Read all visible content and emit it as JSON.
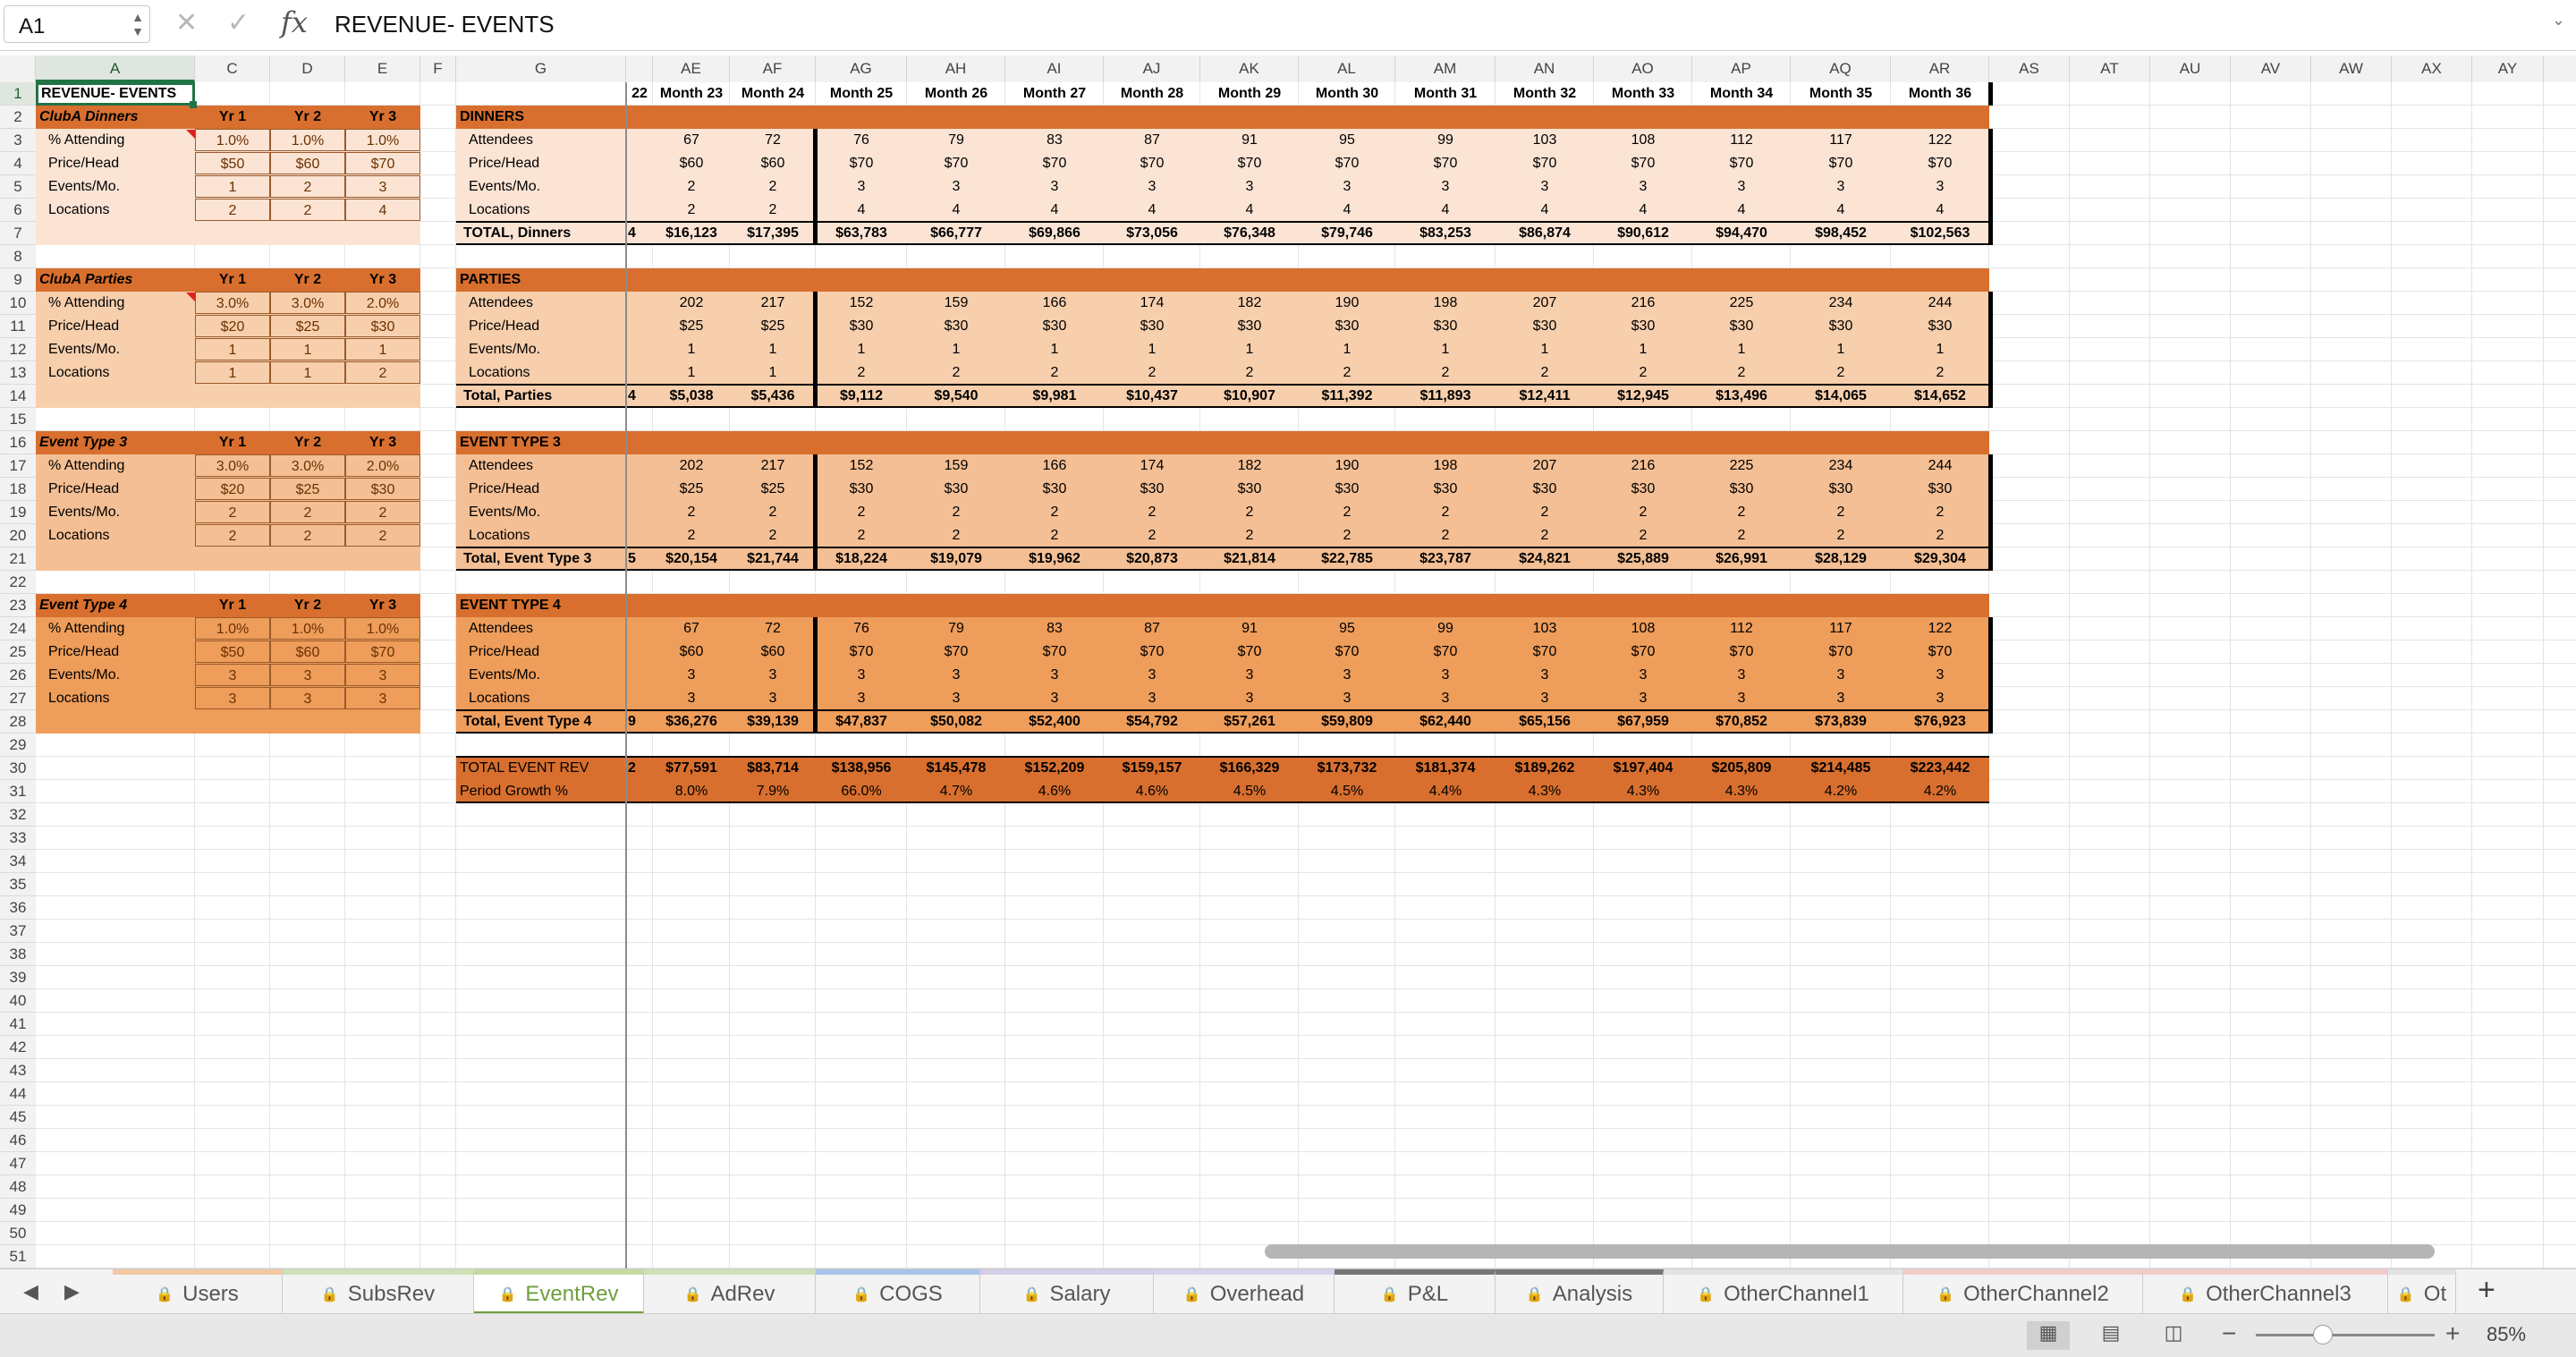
{
  "formula_bar": {
    "name_box": "A1",
    "formula": "REVENUE- EVENTS"
  },
  "columns": [
    "A",
    "C",
    "D",
    "E",
    "F",
    "G",
    "",
    "AE",
    "AF",
    "AG",
    "AH",
    "AI",
    "AJ",
    "AK",
    "AL",
    "AM",
    "AN",
    "AO",
    "AP",
    "AQ",
    "AR",
    "AS",
    "AT",
    "AU",
    "AV",
    "AW",
    "AX",
    "AY"
  ],
  "rows": [
    "1",
    "2",
    "3",
    "4",
    "5",
    "6",
    "7",
    "8",
    "9",
    "10",
    "11",
    "12",
    "13",
    "14",
    "15",
    "16",
    "17",
    "18",
    "19",
    "20",
    "21",
    "22",
    "23",
    "24",
    "25",
    "26",
    "27",
    "28",
    "29",
    "30",
    "31",
    "32",
    "33",
    "34",
    "35",
    "36",
    "37",
    "38",
    "39",
    "40",
    "41",
    "42",
    "43",
    "44",
    "45",
    "46",
    "47",
    "48",
    "49",
    "50",
    "51"
  ],
  "sheet_title": "REVENUE- EVENTS",
  "month_headers": {
    "partial": "22",
    "months": [
      "Month 23",
      "Month 24",
      "Month 25",
      "Month 26",
      "Month 27",
      "Month 28",
      "Month 29",
      "Month 30",
      "Month 31",
      "Month 32",
      "Month 33",
      "Month 34",
      "Month 35",
      "Month 36"
    ]
  },
  "left_blocks": [
    {
      "title": "ClubA Dinners",
      "years": [
        "Yr 1",
        "Yr 2",
        "Yr 3"
      ],
      "rows": [
        {
          "label": "% Attending",
          "vals": [
            "1.0%",
            "1.0%",
            "1.0%"
          ]
        },
        {
          "label": "Price/Head",
          "vals": [
            "$50",
            "$60",
            "$70"
          ]
        },
        {
          "label": "Events/Mo.",
          "vals": [
            "1",
            "2",
            "3"
          ]
        },
        {
          "label": "Locations",
          "vals": [
            "2",
            "2",
            "4"
          ]
        }
      ]
    },
    {
      "title": "ClubA Parties",
      "years": [
        "Yr 1",
        "Yr 2",
        "Yr 3"
      ],
      "rows": [
        {
          "label": "% Attending",
          "vals": [
            "3.0%",
            "3.0%",
            "2.0%"
          ]
        },
        {
          "label": "Price/Head",
          "vals": [
            "$20",
            "$25",
            "$30"
          ]
        },
        {
          "label": "Events/Mo.",
          "vals": [
            "1",
            "1",
            "1"
          ]
        },
        {
          "label": "Locations",
          "vals": [
            "1",
            "1",
            "2"
          ]
        }
      ]
    },
    {
      "title": "Event Type 3",
      "years": [
        "Yr 1",
        "Yr 2",
        "Yr 3"
      ],
      "rows": [
        {
          "label": "% Attending",
          "vals": [
            "3.0%",
            "3.0%",
            "2.0%"
          ]
        },
        {
          "label": "Price/Head",
          "vals": [
            "$20",
            "$25",
            "$30"
          ]
        },
        {
          "label": "Events/Mo.",
          "vals": [
            "2",
            "2",
            "2"
          ]
        },
        {
          "label": "Locations",
          "vals": [
            "2",
            "2",
            "2"
          ]
        }
      ]
    },
    {
      "title": "Event Type 4",
      "years": [
        "Yr 1",
        "Yr 2",
        "Yr 3"
      ],
      "rows": [
        {
          "label": "% Attending",
          "vals": [
            "1.0%",
            "1.0%",
            "1.0%"
          ]
        },
        {
          "label": "Price/Head",
          "vals": [
            "$50",
            "$60",
            "$70"
          ]
        },
        {
          "label": "Events/Mo.",
          "vals": [
            "3",
            "3",
            "3"
          ]
        },
        {
          "label": "Locations",
          "vals": [
            "3",
            "3",
            "3"
          ]
        }
      ]
    }
  ],
  "right_blocks": [
    {
      "title": "DINNERS",
      "rows": [
        {
          "label": "Attendees",
          "vals": [
            "67",
            "72",
            "76",
            "79",
            "83",
            "87",
            "91",
            "95",
            "99",
            "103",
            "108",
            "112",
            "117",
            "122"
          ]
        },
        {
          "label": "Price/Head",
          "vals": [
            "$60",
            "$60",
            "$70",
            "$70",
            "$70",
            "$70",
            "$70",
            "$70",
            "$70",
            "$70",
            "$70",
            "$70",
            "$70",
            "$70"
          ]
        },
        {
          "label": "Events/Mo.",
          "vals": [
            "2",
            "2",
            "3",
            "3",
            "3",
            "3",
            "3",
            "3",
            "3",
            "3",
            "3",
            "3",
            "3",
            "3"
          ]
        },
        {
          "label": "Locations",
          "vals": [
            "2",
            "2",
            "4",
            "4",
            "4",
            "4",
            "4",
            "4",
            "4",
            "4",
            "4",
            "4",
            "4",
            "4"
          ]
        }
      ],
      "total": {
        "label": "TOTAL, Dinners",
        "partial": "4",
        "vals": [
          "$16,123",
          "$17,395",
          "$63,783",
          "$66,777",
          "$69,866",
          "$73,056",
          "$76,348",
          "$79,746",
          "$83,253",
          "$86,874",
          "$90,612",
          "$94,470",
          "$98,452",
          "$102,563"
        ]
      }
    },
    {
      "title": "PARTIES",
      "rows": [
        {
          "label": "Attendees",
          "vals": [
            "202",
            "217",
            "152",
            "159",
            "166",
            "174",
            "182",
            "190",
            "198",
            "207",
            "216",
            "225",
            "234",
            "244"
          ]
        },
        {
          "label": "Price/Head",
          "vals": [
            "$25",
            "$25",
            "$30",
            "$30",
            "$30",
            "$30",
            "$30",
            "$30",
            "$30",
            "$30",
            "$30",
            "$30",
            "$30",
            "$30"
          ]
        },
        {
          "label": "Events/Mo.",
          "vals": [
            "1",
            "1",
            "1",
            "1",
            "1",
            "1",
            "1",
            "1",
            "1",
            "1",
            "1",
            "1",
            "1",
            "1"
          ]
        },
        {
          "label": "Locations",
          "vals": [
            "1",
            "1",
            "2",
            "2",
            "2",
            "2",
            "2",
            "2",
            "2",
            "2",
            "2",
            "2",
            "2",
            "2"
          ]
        }
      ],
      "total": {
        "label": "Total, Parties",
        "partial": "4",
        "vals": [
          "$5,038",
          "$5,436",
          "$9,112",
          "$9,540",
          "$9,981",
          "$10,437",
          "$10,907",
          "$11,392",
          "$11,893",
          "$12,411",
          "$12,945",
          "$13,496",
          "$14,065",
          "$14,652"
        ]
      }
    },
    {
      "title": "EVENT TYPE 3",
      "rows": [
        {
          "label": "Attendees",
          "vals": [
            "202",
            "217",
            "152",
            "159",
            "166",
            "174",
            "182",
            "190",
            "198",
            "207",
            "216",
            "225",
            "234",
            "244"
          ]
        },
        {
          "label": "Price/Head",
          "vals": [
            "$25",
            "$25",
            "$30",
            "$30",
            "$30",
            "$30",
            "$30",
            "$30",
            "$30",
            "$30",
            "$30",
            "$30",
            "$30",
            "$30"
          ]
        },
        {
          "label": "Events/Mo.",
          "vals": [
            "2",
            "2",
            "2",
            "2",
            "2",
            "2",
            "2",
            "2",
            "2",
            "2",
            "2",
            "2",
            "2",
            "2"
          ]
        },
        {
          "label": "Locations",
          "vals": [
            "2",
            "2",
            "2",
            "2",
            "2",
            "2",
            "2",
            "2",
            "2",
            "2",
            "2",
            "2",
            "2",
            "2"
          ]
        }
      ],
      "total": {
        "label": "Total, Event Type 3",
        "partial": "5",
        "vals": [
          "$20,154",
          "$21,744",
          "$18,224",
          "$19,079",
          "$19,962",
          "$20,873",
          "$21,814",
          "$22,785",
          "$23,787",
          "$24,821",
          "$25,889",
          "$26,991",
          "$28,129",
          "$29,304"
        ]
      }
    },
    {
      "title": "EVENT TYPE 4",
      "rows": [
        {
          "label": "Attendees",
          "vals": [
            "67",
            "72",
            "76",
            "79",
            "83",
            "87",
            "91",
            "95",
            "99",
            "103",
            "108",
            "112",
            "117",
            "122"
          ]
        },
        {
          "label": "Price/Head",
          "vals": [
            "$60",
            "$60",
            "$70",
            "$70",
            "$70",
            "$70",
            "$70",
            "$70",
            "$70",
            "$70",
            "$70",
            "$70",
            "$70",
            "$70"
          ]
        },
        {
          "label": "Events/Mo.",
          "vals": [
            "3",
            "3",
            "3",
            "3",
            "3",
            "3",
            "3",
            "3",
            "3",
            "3",
            "3",
            "3",
            "3",
            "3"
          ]
        },
        {
          "label": "Locations",
          "vals": [
            "3",
            "3",
            "3",
            "3",
            "3",
            "3",
            "3",
            "3",
            "3",
            "3",
            "3",
            "3",
            "3",
            "3"
          ]
        }
      ],
      "total": {
        "label": "Total, Event Type 4",
        "partial": "9",
        "vals": [
          "$36,276",
          "$39,139",
          "$47,837",
          "$50,082",
          "$52,400",
          "$54,792",
          "$57,261",
          "$59,809",
          "$62,440",
          "$65,156",
          "$67,959",
          "$70,852",
          "$73,839",
          "$76,923"
        ]
      }
    }
  ],
  "total_event_rev": {
    "label": "TOTAL EVENT REV",
    "partial": "2",
    "vals": [
      "$77,591",
      "$83,714",
      "$138,956",
      "$145,478",
      "$152,209",
      "$159,157",
      "$166,329",
      "$173,732",
      "$181,374",
      "$189,262",
      "$197,404",
      "$205,809",
      "$214,485",
      "$223,442"
    ]
  },
  "period_growth": {
    "label": "Period Growth %",
    "vals": [
      "8.0%",
      "7.9%",
      "66.0%",
      "4.7%",
      "4.6%",
      "4.6%",
      "4.5%",
      "4.5%",
      "4.4%",
      "4.3%",
      "4.3%",
      "4.3%",
      "4.2%",
      "4.2%"
    ]
  },
  "tabs": [
    {
      "label": "Users",
      "color": "#f3c9a4"
    },
    {
      "label": "SubsRev",
      "color": "#cfe0b5"
    },
    {
      "label": "EventRev",
      "color": "#c6dba2"
    },
    {
      "label": "AdRev",
      "color": "#cfe0b5"
    },
    {
      "label": "COGS",
      "color": "#a9c3ea"
    },
    {
      "label": "Salary",
      "color": "#d6cde6"
    },
    {
      "label": "Overhead",
      "color": "#d8d2e8"
    },
    {
      "label": "P&L",
      "color": "#777777"
    },
    {
      "label": "Analysis",
      "color": "#777777"
    },
    {
      "label": "OtherChannel1",
      "color": "#e3e3e3"
    },
    {
      "label": "OtherChannel2",
      "color": "#f2cbc7"
    },
    {
      "label": "OtherChannel3",
      "color": "#f2cbc7"
    },
    {
      "label": "Ot",
      "color": "#e3e3e3"
    }
  ],
  "active_tab": "EventRev",
  "zoom": "85%",
  "colors": {
    "title_bar": "#d86f2e",
    "block1_fill": "#fbe4d4",
    "block2_fill": "#f7cfad",
    "block3_fill": "#f4bf94",
    "block4_fill": "#ee9d5a",
    "accent": "#217346",
    "tab_active": "#6f9e3c"
  }
}
